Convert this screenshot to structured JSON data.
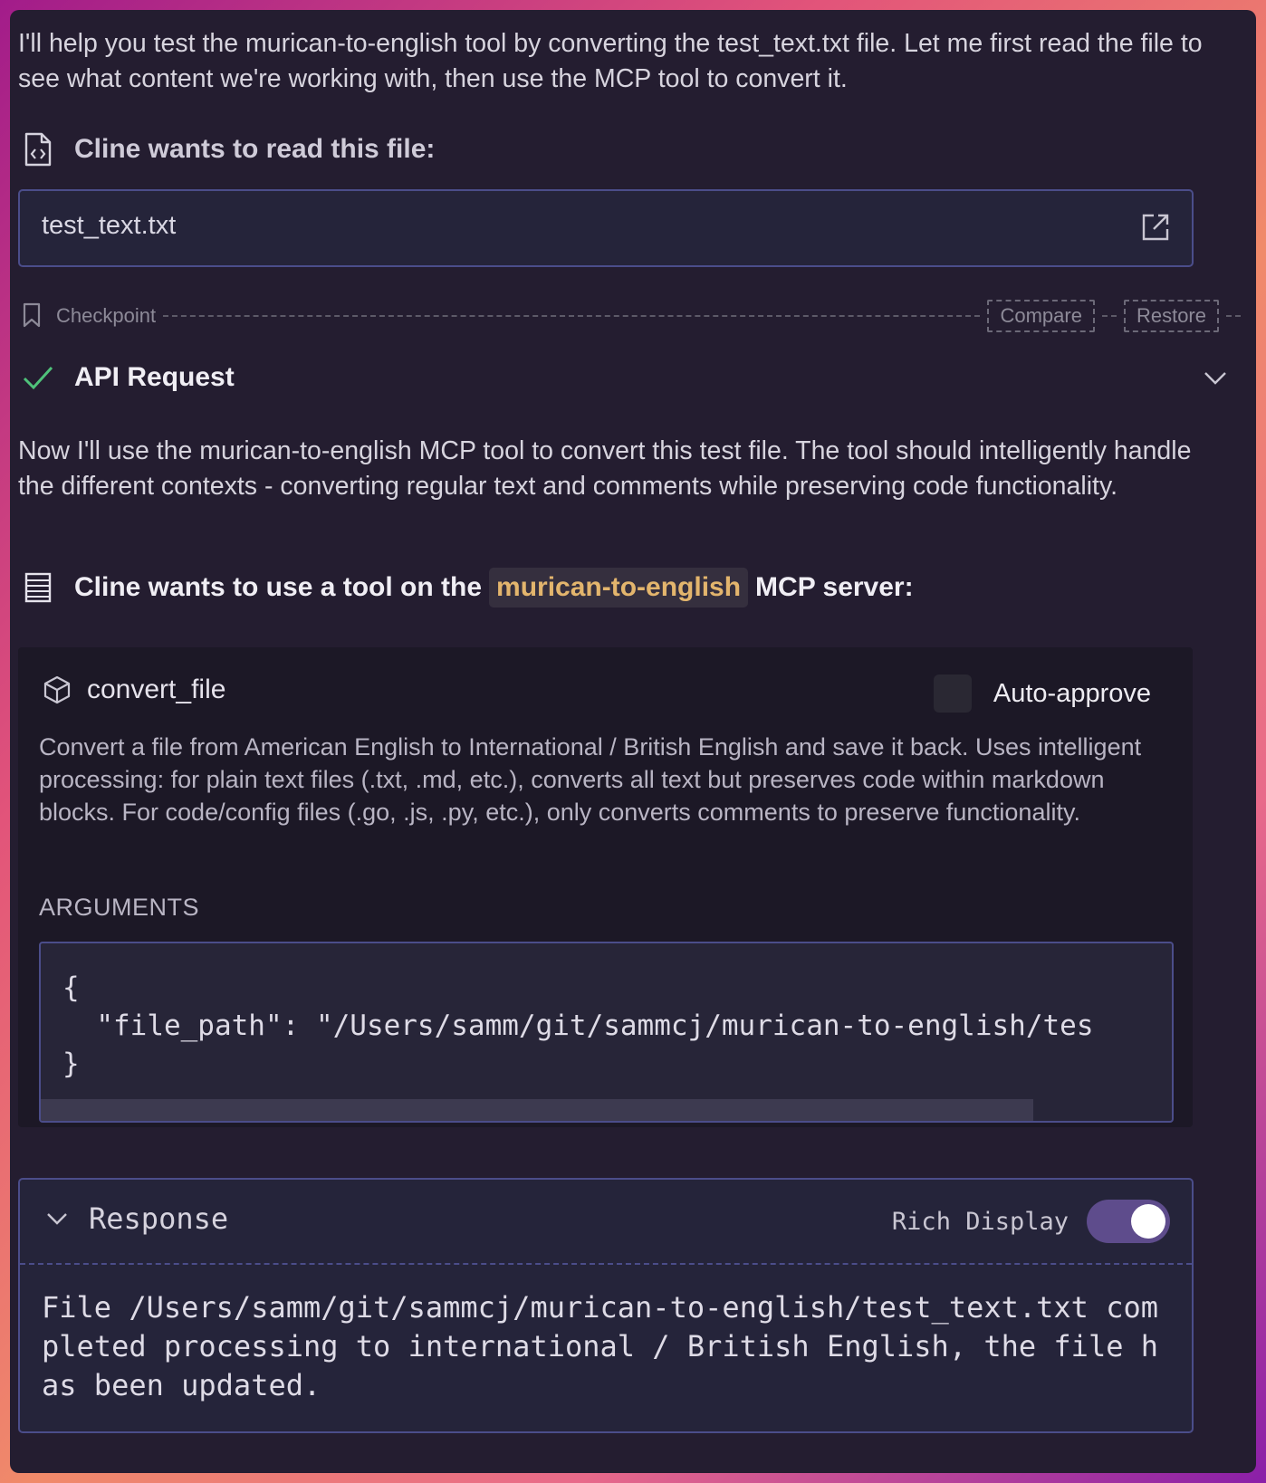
{
  "intro_text": "I'll help you test the murican-to-english tool by converting the test_text.txt file. Let me first read the file to see what content we're working with, then use the MCP tool to convert it.",
  "read_file": {
    "heading": "Cline wants to read this file:",
    "file_name": "test_text.txt",
    "icon": "file-code-icon"
  },
  "checkpoint": {
    "label": "Checkpoint",
    "compare_label": "Compare",
    "restore_label": "Restore"
  },
  "api_request": {
    "label": "API Request",
    "status": "success"
  },
  "plan_text": "Now I'll use the murican-to-english MCP tool to convert this test file. The tool should intelligently handle the different contexts - converting regular text and comments while preserving code functionality.",
  "mcp": {
    "heading_prefix": "Cline wants to use a tool on the",
    "server_name": "murican-to-english",
    "heading_suffix": "MCP server:"
  },
  "tool": {
    "name": "convert_file",
    "auto_approve_label": "Auto-approve",
    "auto_approve_checked": false,
    "description": "Convert a file from American English to International / British English and save it back. Uses intelligent processing: for plain text files (.txt, .md, etc.), converts all text but preserves code within markdown blocks. For code/config files (.go, .js, .py, etc.), only converts comments to preserve functionality.",
    "arguments_label": "ARGUMENTS",
    "arguments_code": "{\n  \"file_path\": \"/Users/samm/git/sammcj/murican-to-english/tes\n}"
  },
  "response": {
    "title": "Response",
    "rich_display_label": "Rich Display",
    "rich_display_on": true,
    "text": "File /Users/samm/git/sammcj/murican-to-english/test_text.txt completed processing to international / British English, the file has been updated."
  },
  "colors": {
    "accent_border": "#4b4d8a",
    "server_tag": "#e3b56d",
    "success": "#4fc27a",
    "toggle": "#5e4c8c"
  }
}
